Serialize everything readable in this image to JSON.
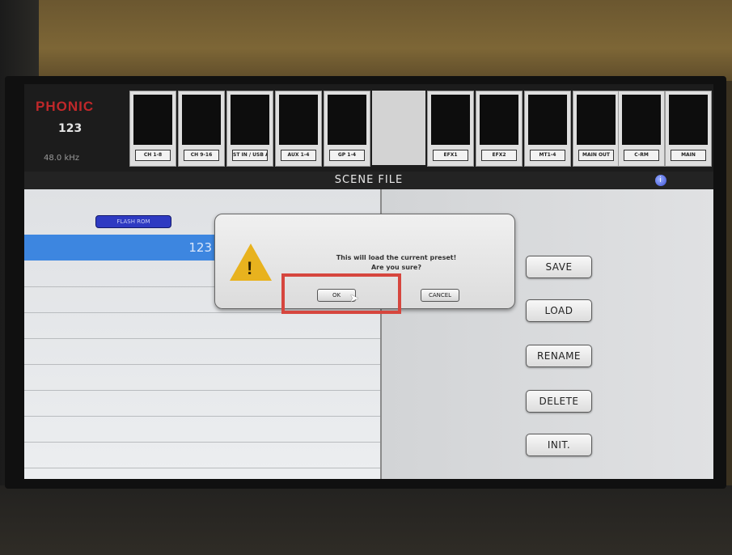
{
  "header": {
    "brand": "PHONIC",
    "preset_number": "123",
    "sample_rate": "48.0 kHz"
  },
  "meters": [
    {
      "label": "CH 1-8"
    },
    {
      "label": "CH 9-16"
    },
    {
      "label": "ST IN / USB AUDIO"
    },
    {
      "label": "AUX 1-4"
    },
    {
      "label": "GP 1-4"
    },
    {
      "label": "EFX1"
    },
    {
      "label": "EFX2"
    },
    {
      "label": "MT1-4"
    },
    {
      "label": "MAIN OUT"
    },
    {
      "label": "C-RM"
    },
    {
      "label": "MAIN"
    }
  ],
  "titlebar": {
    "title": "SCENE FILE"
  },
  "left_panel": {
    "flash_button": "FLASH ROM",
    "selected_row": "123"
  },
  "dialog": {
    "message_line1": "This will load the current preset!",
    "message_line2": "Are you sure?",
    "ok_label": "OK",
    "cancel_label": "CANCEL"
  },
  "side_buttons": {
    "save": "SAVE",
    "load": "LOAD",
    "rename": "RENAME",
    "delete": "DELETE",
    "init": "INIT."
  },
  "colors": {
    "highlight": "#d6463e",
    "selection": "#3d86e0",
    "brand": "#c0282a"
  }
}
